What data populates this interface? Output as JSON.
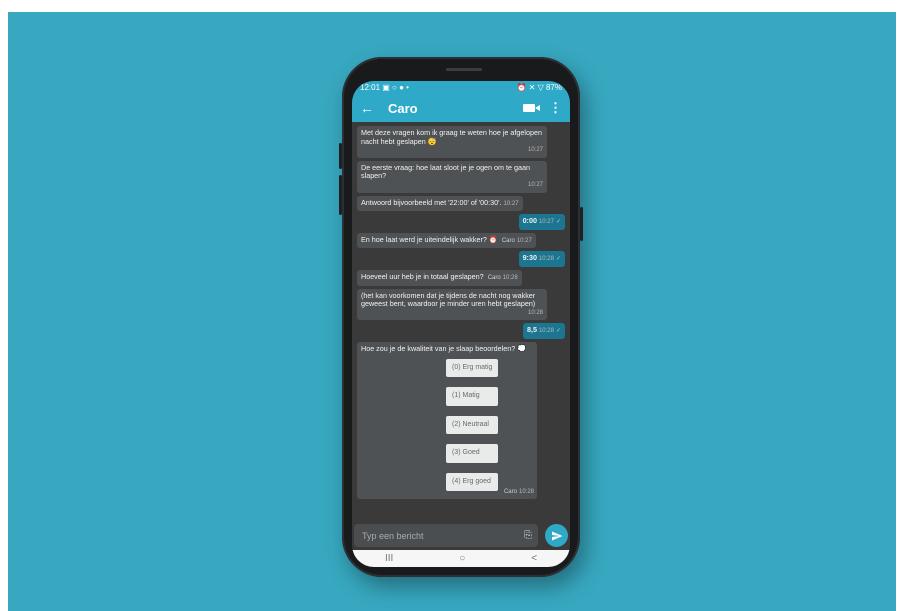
{
  "status_bar": {
    "time": "12:01",
    "left_icons": "▣ ○ ● •",
    "right_icons": "⏰ ✕ ▽",
    "battery": "87%"
  },
  "appbar": {
    "back_icon": "←",
    "contact_name": "Caro",
    "more_icon": "⋮"
  },
  "messages": [
    {
      "type": "in",
      "text": "Met deze vragen kom ik graag te weten hoe je afgelopen nacht hebt geslapen 😴",
      "time": "10:27"
    },
    {
      "type": "in",
      "text": "De eerste vraag: hoe laat sloot je je ogen om te gaan slapen?",
      "time": "10:27"
    },
    {
      "type": "in",
      "text": "Antwoord bijvoorbeeld met '22:00' of '00:30'.",
      "time": "10:27"
    },
    {
      "type": "out",
      "text": "0:00",
      "time": "10:27"
    },
    {
      "type": "in",
      "text": "En hoe laat werd je uiteindelijk wakker? ⏰",
      "sender": "Caro",
      "time": "10:27"
    },
    {
      "type": "out",
      "text": "9:30",
      "time": "10:28"
    },
    {
      "type": "in",
      "text": "Hoeveel uur heb je in totaal geslapen?",
      "sender": "Caro",
      "time": "10:28"
    },
    {
      "type": "in",
      "text": "(het kan voorkomen dat je tijdens de nacht nog wakker geweest bent, waardoor je minder uren hebt geslapen)",
      "time": "10:28"
    },
    {
      "type": "out",
      "text": "8,5",
      "time": "10:28"
    }
  ],
  "rating": {
    "question": "Hoe zou je de kwaliteit van je slaap beoordelen? 💭",
    "options": [
      "(0) Erg matig",
      "(1) Matig",
      "(2) Neutraal",
      "(3) Goed",
      "(4) Erg goed"
    ],
    "sender": "Caro",
    "time": "10:28"
  },
  "composer": {
    "placeholder": "Typ een bericht"
  },
  "navbar": {
    "recent": "III",
    "home": "○",
    "back": "<"
  },
  "checkmark": "✓"
}
